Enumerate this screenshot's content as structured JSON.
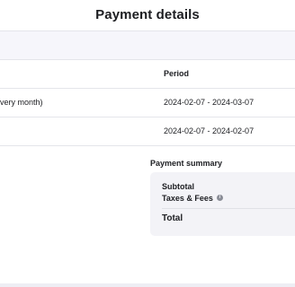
{
  "header": {
    "title": "Payment details"
  },
  "table": {
    "columns": {
      "period": "Period"
    },
    "rows": [
      {
        "description": "very month)",
        "period": "2024-02-07 - 2024-03-07"
      },
      {
        "description": "",
        "period": "2024-02-07 - 2024-02-07"
      }
    ]
  },
  "summary": {
    "heading": "Payment summary",
    "subtotal_label": "Subtotal",
    "taxes_label": "Taxes & Fees",
    "total_label": "Total",
    "info_icon": "info-icon"
  }
}
